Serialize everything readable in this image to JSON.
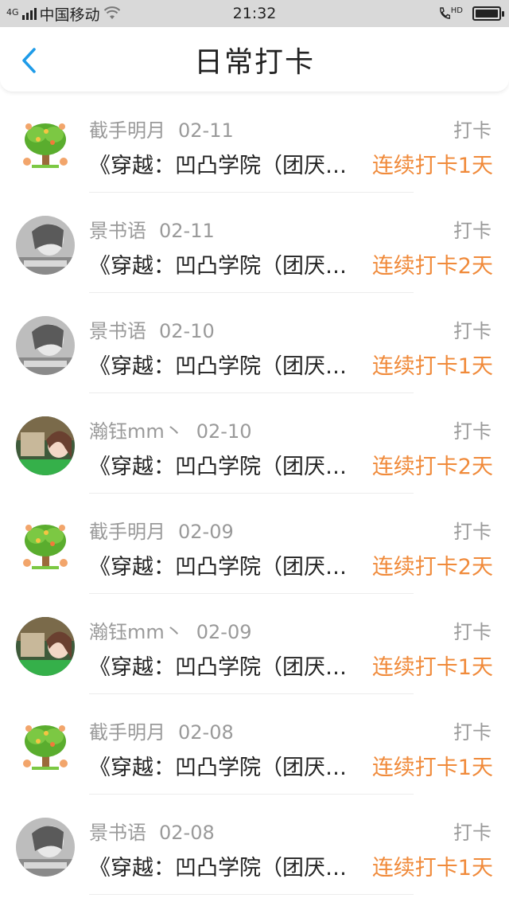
{
  "status_bar": {
    "carrier": "中国移动",
    "network": "4G",
    "time": "21:32",
    "hd_label": "HD"
  },
  "nav": {
    "title": "日常打卡"
  },
  "items": [
    {
      "name": "截手明月",
      "date": "02-11",
      "action": "打卡",
      "content": "《穿越：凹凸学院（团厌…",
      "streak": "连续打卡1天",
      "avatar": "tree"
    },
    {
      "name": "景书语",
      "date": "02-11",
      "action": "打卡",
      "content": "《穿越：凹凸学院（团厌…",
      "streak": "连续打卡2天",
      "avatar": "bw"
    },
    {
      "name": "景书语",
      "date": "02-10",
      "action": "打卡",
      "content": "《穿越：凹凸学院（团厌…",
      "streak": "连续打卡1天",
      "avatar": "bw"
    },
    {
      "name": "瀚钰mm丶",
      "date": "02-10",
      "action": "打卡",
      "content": "《穿越：凹凸学院（团厌…",
      "streak": "连续打卡2天",
      "avatar": "girl"
    },
    {
      "name": "截手明月",
      "date": "02-09",
      "action": "打卡",
      "content": "《穿越：凹凸学院（团厌…",
      "streak": "连续打卡2天",
      "avatar": "tree"
    },
    {
      "name": "瀚钰mm丶",
      "date": "02-09",
      "action": "打卡",
      "content": "《穿越：凹凸学院（团厌…",
      "streak": "连续打卡1天",
      "avatar": "girl"
    },
    {
      "name": "截手明月",
      "date": "02-08",
      "action": "打卡",
      "content": "《穿越：凹凸学院（团厌…",
      "streak": "连续打卡1天",
      "avatar": "tree"
    },
    {
      "name": "景书语",
      "date": "02-08",
      "action": "打卡",
      "content": "《穿越：凹凸学院（团厌…",
      "streak": "连续打卡1天",
      "avatar": "bw"
    }
  ],
  "colors": {
    "accent": "#1e9be8",
    "streak": "#f08a3a",
    "meta": "#9a9a9a"
  }
}
